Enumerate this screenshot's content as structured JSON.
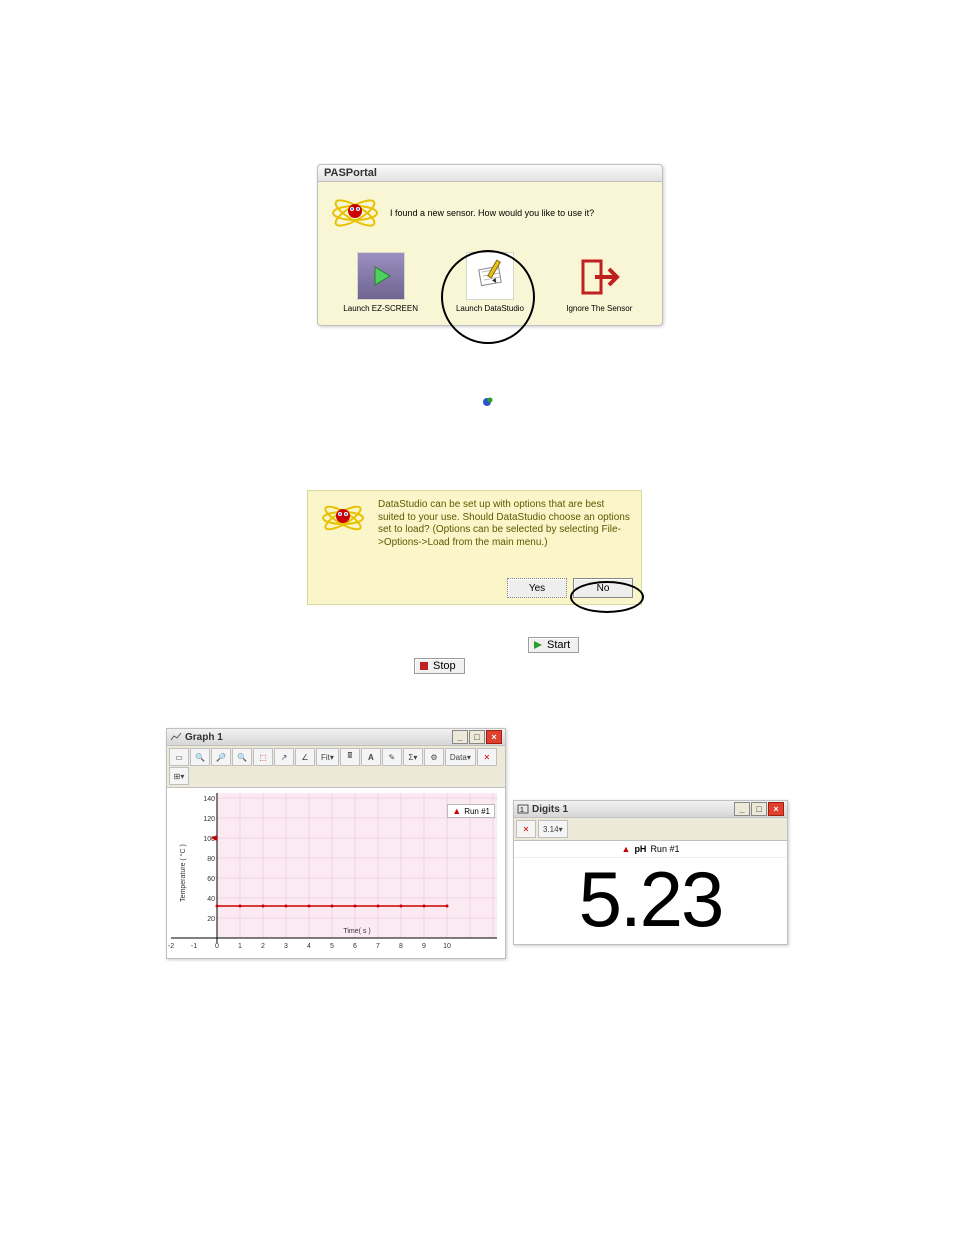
{
  "pasportal": {
    "title": "PASPortal",
    "message": "I found a new sensor. How would you like to use it?",
    "options": {
      "ez": "Launch EZ-SCREEN",
      "ds": "Launch DataStudio",
      "ignore": "Ignore The Sensor"
    }
  },
  "helpbox": {
    "text": "DataStudio can be set up with options that are best suited to your use. Should DataStudio choose an options set to load? (Options can be selected by selecting File->Options->Load from the main menu.)",
    "yes": "Yes",
    "no": "No"
  },
  "buttons": {
    "start": "Start",
    "stop": "Stop"
  },
  "graph": {
    "title": "Graph 1",
    "toolbar": {
      "fit": "Fit",
      "data": "Data"
    },
    "legend": "Run #1",
    "ylabel": "Temperature ( °C )",
    "xlabel": "Time( s )",
    "yticks": [
      "20",
      "40",
      "60",
      "80",
      "100",
      "120",
      "140"
    ],
    "xticks": [
      "-2",
      "-1",
      "0",
      "1",
      "2",
      "3",
      "4",
      "5",
      "6",
      "7",
      "8",
      "9",
      "10"
    ]
  },
  "digits": {
    "title": "Digits 1",
    "toolbar_right": "3.14",
    "legend_name": "pH",
    "legend_run": "Run #1",
    "value": "5.23"
  },
  "chart_data": {
    "type": "line",
    "title": "Graph 1",
    "xlabel": "Time( s )",
    "ylabel": "Temperature ( °C )",
    "xlim": [
      -2,
      10
    ],
    "ylim": [
      0,
      140
    ],
    "series": [
      {
        "name": "Run #1",
        "color": "#cc0000",
        "x": [
          0,
          1,
          2,
          3,
          4,
          5,
          6,
          7,
          8,
          9,
          10
        ],
        "y": [
          32,
          32,
          32,
          32,
          32,
          32,
          32,
          32,
          32,
          32,
          32
        ]
      }
    ]
  }
}
